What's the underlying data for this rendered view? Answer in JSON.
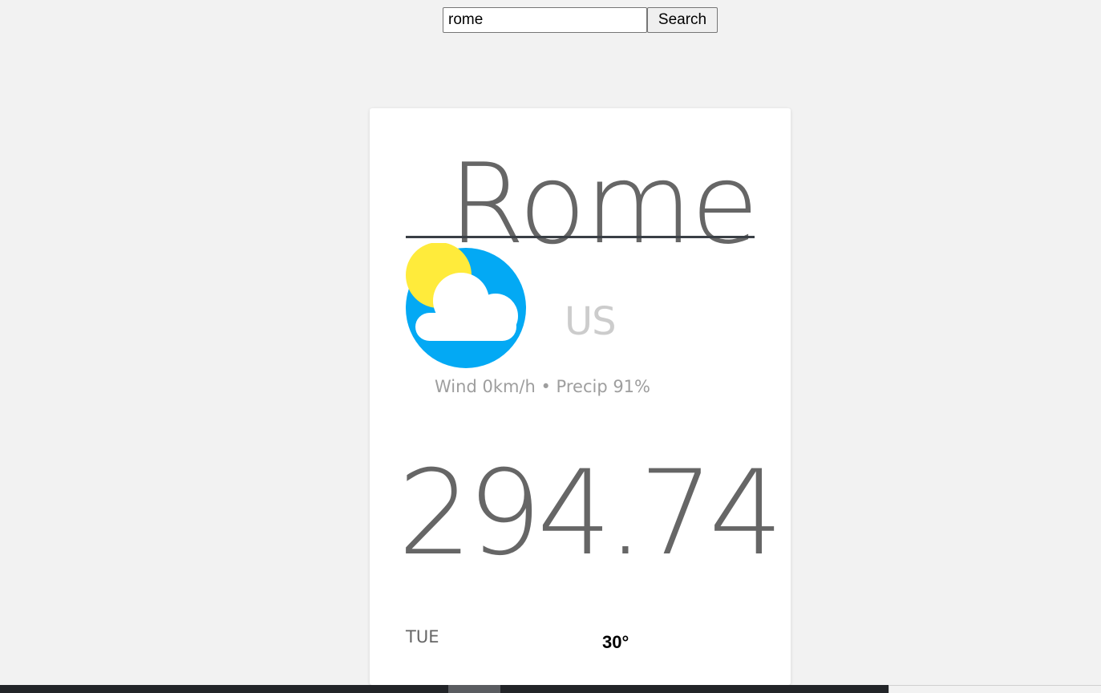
{
  "search": {
    "value": "rome",
    "button_label": "Search"
  },
  "weather": {
    "city": "Rome",
    "country": "US",
    "details": "Wind 0km/h • Precip 91%",
    "temperature": "294.74",
    "icon": "partly-cloudy-icon",
    "forecast": [
      {
        "day": "TUE",
        "temp": "30°"
      }
    ]
  },
  "colors": {
    "icon_circle": "#03a9f4",
    "icon_sun": "#ffeb3b",
    "icon_cloud": "#ffffff",
    "text_primary": "#666666",
    "text_muted": "#cccccc",
    "divider": "#3a3f45"
  }
}
